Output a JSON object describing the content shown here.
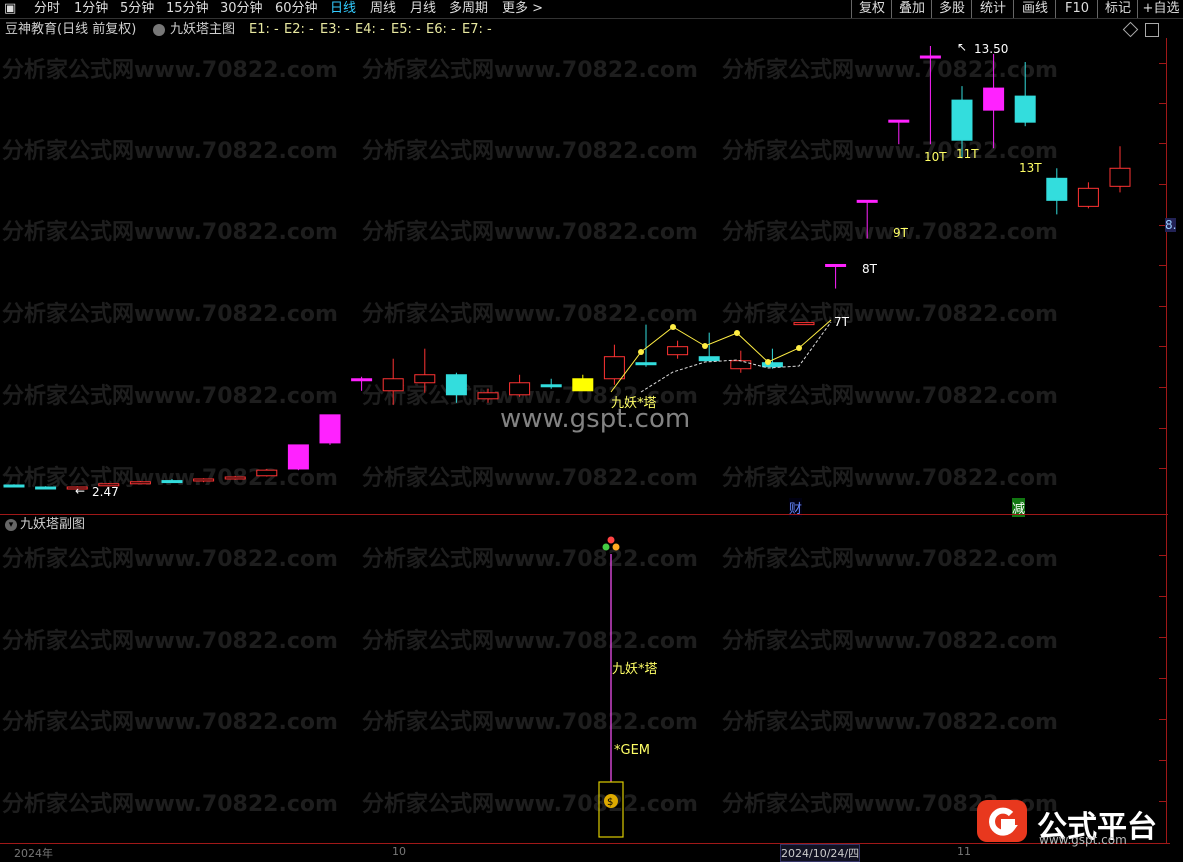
{
  "toolbar": {
    "items": [
      {
        "label": "分时",
        "active": false
      },
      {
        "label": "1分钟",
        "active": false
      },
      {
        "label": "5分钟",
        "active": false
      },
      {
        "label": "15分钟",
        "active": false
      },
      {
        "label": "30分钟",
        "active": false
      },
      {
        "label": "60分钟",
        "active": false
      },
      {
        "label": "日线",
        "active": true
      },
      {
        "label": "周线",
        "active": false
      },
      {
        "label": "月线",
        "active": false
      },
      {
        "label": "多周期",
        "active": false
      },
      {
        "label": "更多 >",
        "active": false
      }
    ],
    "right": [
      {
        "label": "复权"
      },
      {
        "label": "叠加"
      },
      {
        "label": "多股"
      },
      {
        "label": "统计"
      },
      {
        "label": "画线"
      },
      {
        "label": "F10"
      },
      {
        "label": "标记"
      },
      {
        "label": "+自选"
      }
    ]
  },
  "title": {
    "stock": "豆神教育(日线 前复权)",
    "indicator": "九妖塔主图",
    "params": [
      "E1: -",
      "E2: -",
      "E3: -",
      "E4: -",
      "E5: -",
      "E6: -",
      "E7: -"
    ]
  },
  "main_chart": {
    "price_low_label": "2.47",
    "price_high_label": "13.50",
    "right_axis_label": "8.",
    "markers": [
      {
        "text": "7T",
        "color": "#ffffff"
      },
      {
        "text": "8T",
        "color": "#ffffff"
      },
      {
        "text": "9T",
        "color": "#ffff66"
      },
      {
        "text": "10T",
        "color": "#ffff66"
      },
      {
        "text": "11T",
        "color": "#ffff66"
      },
      {
        "text": "13T",
        "color": "#ffff66"
      }
    ],
    "signal_text": "九妖*塔",
    "badges": [
      {
        "text": "财",
        "color": "#6688ff"
      },
      {
        "text": "减",
        "color": "#22aa22"
      }
    ]
  },
  "sub_chart": {
    "title": "九妖塔副图",
    "signal_text": "九妖*塔",
    "gem_text": "*GEM"
  },
  "watermark": {
    "text": "分析家公式网www.70822.com",
    "center": "www.gspt.com"
  },
  "brand": {
    "name": "公式平台",
    "url": "www.gspt.com"
  },
  "bottom_axis": {
    "labels": [
      "2024年",
      "10",
      "2024/10/24/四",
      "11"
    ]
  },
  "colors": {
    "up": "#ff3333",
    "down": "#33dddd",
    "magenta": "#ff22ff",
    "yellow": "#ffff00",
    "grid": "#a01818"
  },
  "chart_data": {
    "type": "candlestick",
    "candles": [
      {
        "o": 2.55,
        "h": 2.57,
        "l": 2.53,
        "c": 2.55,
        "color": "down"
      },
      {
        "o": 2.5,
        "h": 2.52,
        "l": 2.48,
        "c": 2.5,
        "color": "down"
      },
      {
        "o": 2.49,
        "h": 2.52,
        "l": 2.47,
        "c": 2.5,
        "color": "up"
      },
      {
        "o": 2.55,
        "h": 2.6,
        "l": 2.53,
        "c": 2.58,
        "color": "up"
      },
      {
        "o": 2.6,
        "h": 2.65,
        "l": 2.58,
        "c": 2.63,
        "color": "up"
      },
      {
        "o": 2.64,
        "h": 2.7,
        "l": 2.62,
        "c": 2.66,
        "color": "down"
      },
      {
        "o": 2.66,
        "h": 2.72,
        "l": 2.62,
        "c": 2.7,
        "color": "up"
      },
      {
        "o": 2.72,
        "h": 2.78,
        "l": 2.68,
        "c": 2.75,
        "color": "up"
      },
      {
        "o": 2.78,
        "h": 2.95,
        "l": 2.76,
        "c": 2.92,
        "color": "up"
      },
      {
        "o": 2.95,
        "h": 3.55,
        "l": 2.92,
        "c": 3.55,
        "color": "magenta"
      },
      {
        "o": 3.6,
        "h": 4.3,
        "l": 3.55,
        "c": 4.3,
        "color": "magenta"
      },
      {
        "o": 5.2,
        "h": 5.25,
        "l": 4.9,
        "c": 5.2,
        "color": "magenta"
      },
      {
        "o": 4.9,
        "h": 5.7,
        "l": 4.55,
        "c": 5.2,
        "color": "up"
      },
      {
        "o": 5.1,
        "h": 5.95,
        "l": 4.85,
        "c": 5.3,
        "color": "up"
      },
      {
        "o": 5.3,
        "h": 5.35,
        "l": 4.6,
        "c": 4.8,
        "color": "down"
      },
      {
        "o": 4.7,
        "h": 4.95,
        "l": 4.6,
        "c": 4.85,
        "color": "up"
      },
      {
        "o": 4.8,
        "h": 5.3,
        "l": 4.75,
        "c": 5.1,
        "color": "up"
      },
      {
        "o": 5.05,
        "h": 5.2,
        "l": 4.95,
        "c": 5.0,
        "color": "down"
      },
      {
        "o": 4.9,
        "h": 5.3,
        "l": 4.9,
        "c": 5.2,
        "color": "yellow"
      },
      {
        "o": 5.2,
        "h": 6.05,
        "l": 5.05,
        "c": 5.75,
        "color": "up"
      },
      {
        "o": 5.6,
        "h": 6.55,
        "l": 5.5,
        "c": 5.6,
        "color": "down"
      },
      {
        "o": 5.8,
        "h": 6.15,
        "l": 5.7,
        "c": 6.0,
        "color": "up"
      },
      {
        "o": 5.75,
        "h": 6.35,
        "l": 5.65,
        "c": 5.65,
        "color": "down"
      },
      {
        "o": 5.45,
        "h": 5.9,
        "l": 5.35,
        "c": 5.65,
        "color": "up"
      },
      {
        "o": 5.6,
        "h": 5.95,
        "l": 5.45,
        "c": 5.5,
        "color": "down"
      },
      {
        "o": 6.6,
        "h": 6.6,
        "l": 6.55,
        "c": 6.6,
        "color": "up"
      },
      {
        "o": 8.05,
        "h": 8.05,
        "l": 7.45,
        "c": 8.05,
        "color": "magenta"
      },
      {
        "o": 9.65,
        "h": 9.65,
        "l": 8.7,
        "c": 9.65,
        "color": "magenta"
      },
      {
        "o": 11.65,
        "h": 11.65,
        "l": 11.05,
        "c": 11.65,
        "color": "magenta"
      },
      {
        "o": 13.25,
        "h": 13.5,
        "l": 11.05,
        "c": 13.25,
        "color": "magenta"
      },
      {
        "o": 12.15,
        "h": 12.5,
        "l": 10.7,
        "c": 11.15,
        "color": "down"
      },
      {
        "o": 11.9,
        "h": 13.3,
        "l": 10.95,
        "c": 12.45,
        "color": "magenta"
      },
      {
        "o": 12.25,
        "h": 13.1,
        "l": 11.5,
        "c": 11.6,
        "color": "down"
      },
      {
        "o": 10.2,
        "h": 10.45,
        "l": 9.3,
        "c": 9.65,
        "color": "down"
      },
      {
        "o": 9.5,
        "h": 10.1,
        "l": 9.45,
        "c": 9.95,
        "color": "up"
      },
      {
        "o": 10.0,
        "h": 11.0,
        "l": 9.85,
        "c": 10.45,
        "color": "up"
      }
    ]
  }
}
